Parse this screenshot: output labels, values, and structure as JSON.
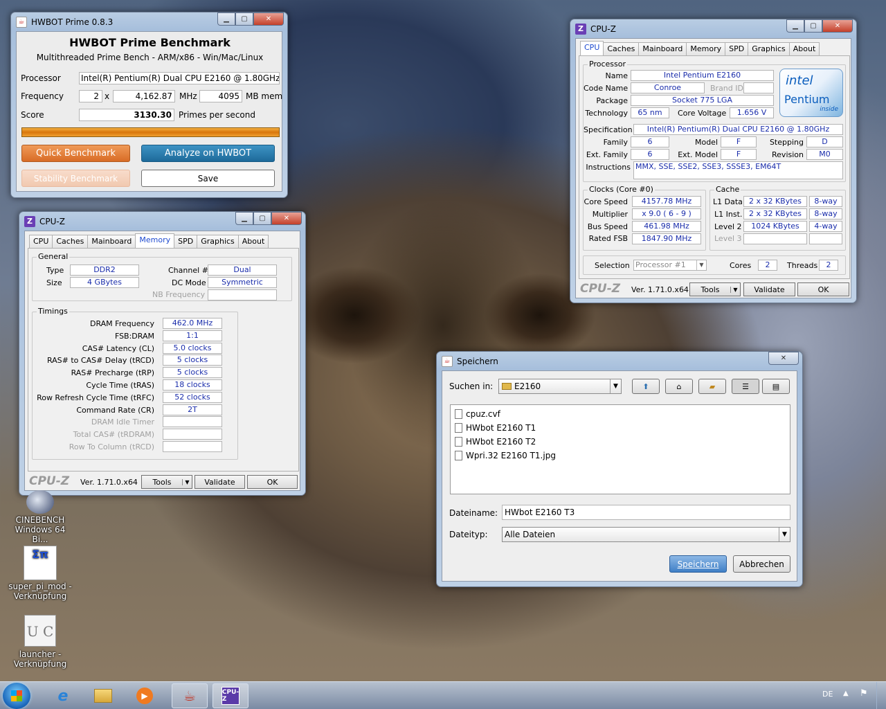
{
  "hwbot": {
    "title": "HWBOT Prime 0.8.3",
    "heading": "HWBOT Prime Benchmark",
    "subheading": "Multithreaded Prime Bench - ARM/x86 - Win/Mac/Linux",
    "processor_label": "Processor",
    "processor_value": "Intel(R) Pentium(R) Dual  CPU  E2160  @ 1.80GHz",
    "frequency_label": "Frequency",
    "cores": "2",
    "x": "x",
    "frequency_value": "4,162.87",
    "mhz": "MHz",
    "mem_value": "4095",
    "mem_unit": "MB mem",
    "score_label": "Score",
    "score_value": "3130.30",
    "score_unit": "Primes per second",
    "progress": 1.0,
    "quick": "Quick Benchmark",
    "analyze": "Analyze on HWBOT",
    "stability": "Stability Benchmark",
    "save": "Save"
  },
  "cpuz_mem": {
    "title": "CPU-Z",
    "tabs": [
      "CPU",
      "Caches",
      "Mainboard",
      "Memory",
      "SPD",
      "Graphics",
      "About"
    ],
    "general": "General",
    "type_label": "Type",
    "type": "DDR2",
    "size_label": "Size",
    "size": "4 GBytes",
    "channel_label": "Channel #",
    "channel": "Dual",
    "dc_label": "DC Mode",
    "dc": "Symmetric",
    "nb_label": "NB Frequency",
    "timings": "Timings",
    "rows": [
      {
        "l": "DRAM Frequency",
        "v": "462.0 MHz"
      },
      {
        "l": "FSB:DRAM",
        "v": "1:1"
      },
      {
        "l": "CAS# Latency (CL)",
        "v": "5.0 clocks"
      },
      {
        "l": "RAS# to CAS# Delay (tRCD)",
        "v": "5 clocks"
      },
      {
        "l": "RAS# Precharge (tRP)",
        "v": "5 clocks"
      },
      {
        "l": "Cycle Time (tRAS)",
        "v": "18 clocks"
      },
      {
        "l": "Row Refresh Cycle Time (tRFC)",
        "v": "52 clocks"
      },
      {
        "l": "Command Rate (CR)",
        "v": "2T"
      }
    ],
    "grey_rows": [
      "DRAM Idle Timer",
      "Total CAS# (tRDRAM)",
      "Row To Column (tRCD)"
    ],
    "brand": "CPU-Z",
    "ver": "Ver. 1.71.0.x64",
    "tools": "Tools",
    "validate": "Validate",
    "ok": "OK"
  },
  "cpuz_cpu": {
    "title": "CPU-Z",
    "tabs": [
      "CPU",
      "Caches",
      "Mainboard",
      "Memory",
      "SPD",
      "Graphics",
      "About"
    ],
    "processor": "Processor",
    "name_label": "Name",
    "name": "Intel Pentium E2160",
    "code_label": "Code Name",
    "code": "Conroe",
    "brand_id": "Brand ID",
    "package_label": "Package",
    "package": "Socket 775 LGA",
    "tech_label": "Technology",
    "tech": "65 nm",
    "volt_label": "Core Voltage",
    "volt": "1.656 V",
    "spec_label": "Specification",
    "spec": "Intel(R) Pentium(R) Dual  CPU  E2160  @ 1.80GHz",
    "family_label": "Family",
    "family": "6",
    "model_label": "Model",
    "model": "F",
    "stepping_label": "Stepping",
    "stepping": "D",
    "extfam_label": "Ext. Family",
    "extfam": "6",
    "extmodel_label": "Ext. Model",
    "extmodel": "F",
    "rev_label": "Revision",
    "rev": "M0",
    "instr_label": "Instructions",
    "instr": "MMX, SSE, SSE2, SSE3, SSSE3, EM64T",
    "logo_intel": "intel",
    "logo_pentium": "Pentium",
    "logo_inside": "inside",
    "clocks": "Clocks (Core #0)",
    "core_speed_label": "Core Speed",
    "core_speed": "4157.78 MHz",
    "mult_label": "Multiplier",
    "mult": "x 9.0 ( 6 - 9 )",
    "bus_label": "Bus Speed",
    "bus": "461.98 MHz",
    "fsb_label": "Rated FSB",
    "fsb": "1847.90 MHz",
    "cache": "Cache",
    "l1d_label": "L1 Data",
    "l1d": "2 x 32 KBytes",
    "l1d_way": "8-way",
    "l1i_label": "L1 Inst.",
    "l1i": "2 x 32 KBytes",
    "l1i_way": "8-way",
    "l2_label": "Level 2",
    "l2": "1024 KBytes",
    "l2_way": "4-way",
    "l3_label": "Level 3",
    "sel_label": "Selection",
    "sel": "Processor #1",
    "cores_label": "Cores",
    "cores": "2",
    "threads_label": "Threads",
    "threads": "2",
    "brand": "CPU-Z",
    "ver": "Ver. 1.71.0.x64",
    "tools": "Tools",
    "validate": "Validate",
    "ok": "OK"
  },
  "save_dlg": {
    "title": "Speichern",
    "look_label": "Suchen in:",
    "folder": "E2160",
    "files": [
      "cpuz.cvf",
      "HWbot E2160 T1",
      "HWbot E2160 T2",
      "Wpri.32 E2160 T1.jpg"
    ],
    "filename_label": "Dateiname:",
    "filename": "HWbot E2160 T3",
    "filetype_label": "Dateityp:",
    "filetype": "Alle Dateien",
    "save": "Speichern",
    "cancel": "Abbrechen"
  },
  "desktop": {
    "icons": [
      {
        "l1": "CINEBENCH",
        "l2": "Windows 64 Bi..."
      },
      {
        "l1": "super_pi_mod -",
        "l2": "Verknüpfung"
      },
      {
        "l1": "launcher -",
        "l2": "Verknüpfung"
      }
    ]
  },
  "taskbar": {
    "lang": "DE"
  }
}
